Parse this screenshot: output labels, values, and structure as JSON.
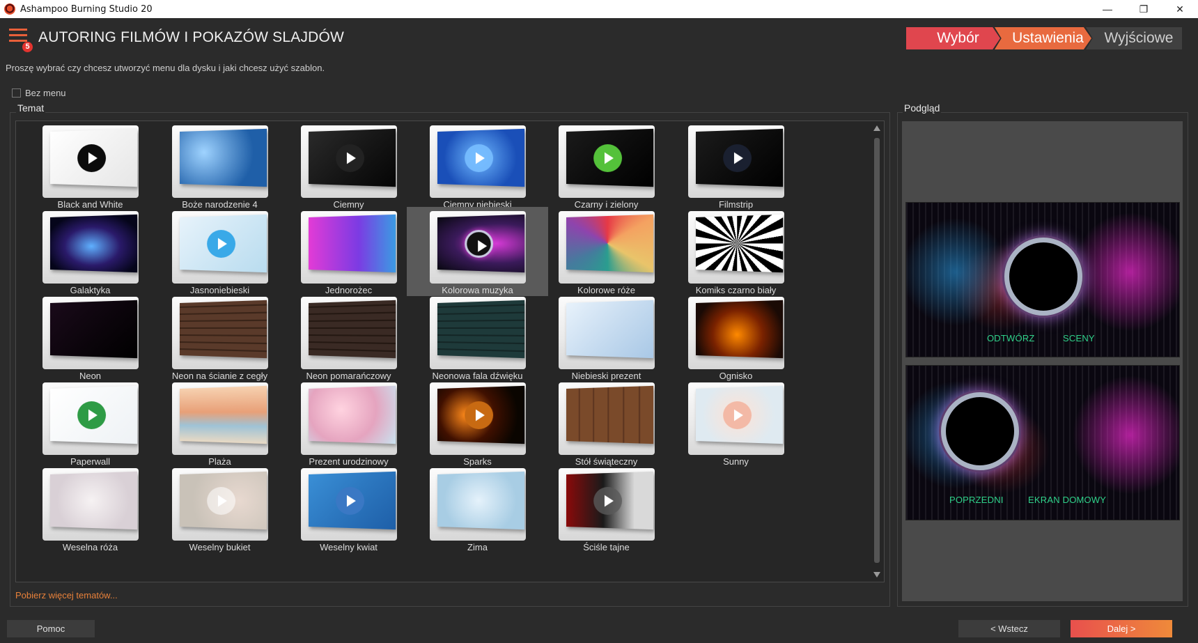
{
  "window": {
    "title": "Ashampoo Burning Studio 20",
    "minimize": "—",
    "maximize": "❐",
    "close": "✕"
  },
  "header": {
    "badge": "5",
    "title": "AUTORING FILMÓW I POKAZÓW SLAJDÓW",
    "subtitle": "Proszę wybrać czy chcesz utworzyć menu dla dysku i jaki chcesz użyć szablon."
  },
  "steps": [
    "Wybór",
    "Ustawienia",
    "Wyjściowe"
  ],
  "no_menu_label": "Bez menu",
  "theme_group_label": "Temat",
  "themes": [
    {
      "label": "Black and White",
      "style": "bw"
    },
    {
      "label": "Boże narodzenie 4",
      "style": "xmas"
    },
    {
      "label": "Ciemny",
      "style": "dark"
    },
    {
      "label": "Ciemny niebieski",
      "style": "darkblue"
    },
    {
      "label": "Czarny i zielony",
      "style": "blackgreen"
    },
    {
      "label": "Filmstrip",
      "style": "filmstrip"
    },
    {
      "label": "Galaktyka",
      "style": "galaxy"
    },
    {
      "label": "Jasnoniebieski",
      "style": "lightblue"
    },
    {
      "label": "Jednorożec",
      "style": "unicorn"
    },
    {
      "label": "Kolorowa muzyka",
      "style": "music"
    },
    {
      "label": "Kolorowe róże",
      "style": "roses"
    },
    {
      "label": "Komiks czarno biały",
      "style": "comic"
    },
    {
      "label": "Neon",
      "style": "neon"
    },
    {
      "label": "Neon na ścianie z cegły",
      "style": "brick"
    },
    {
      "label": "Neon pomarańczowy",
      "style": "neonorange"
    },
    {
      "label": "Neonowa fala dźwięku",
      "style": "wave"
    },
    {
      "label": "Niebieski prezent",
      "style": "gift"
    },
    {
      "label": "Ognisko",
      "style": "fire"
    },
    {
      "label": "Paperwall",
      "style": "paperwall"
    },
    {
      "label": "Plaża",
      "style": "beach"
    },
    {
      "label": "Prezent urodzinowy",
      "style": "birthday"
    },
    {
      "label": "Sparks",
      "style": "sparks"
    },
    {
      "label": "Stół świąteczny",
      "style": "table"
    },
    {
      "label": "Sunny",
      "style": "sunny"
    },
    {
      "label": "Weselna róża",
      "style": "rose"
    },
    {
      "label": "Weselny bukiet",
      "style": "bouquet"
    },
    {
      "label": "Weselny kwiat",
      "style": "flower"
    },
    {
      "label": "Zima",
      "style": "winter"
    },
    {
      "label": "Ściśle tajne",
      "style": "secret"
    }
  ],
  "selected_theme_index": 9,
  "more_themes_link": "Pobierz więcej tematów...",
  "preview": {
    "label": "Podgląd",
    "screen1": {
      "left": "ODTWÓRZ",
      "right": "SCENY"
    },
    "screen2": {
      "left": "POPRZEDNI",
      "right": "EKRAN DOMOWY"
    }
  },
  "buttons": {
    "help": "Pomoc",
    "back": "< Wstecz",
    "next": "Dalej >"
  }
}
